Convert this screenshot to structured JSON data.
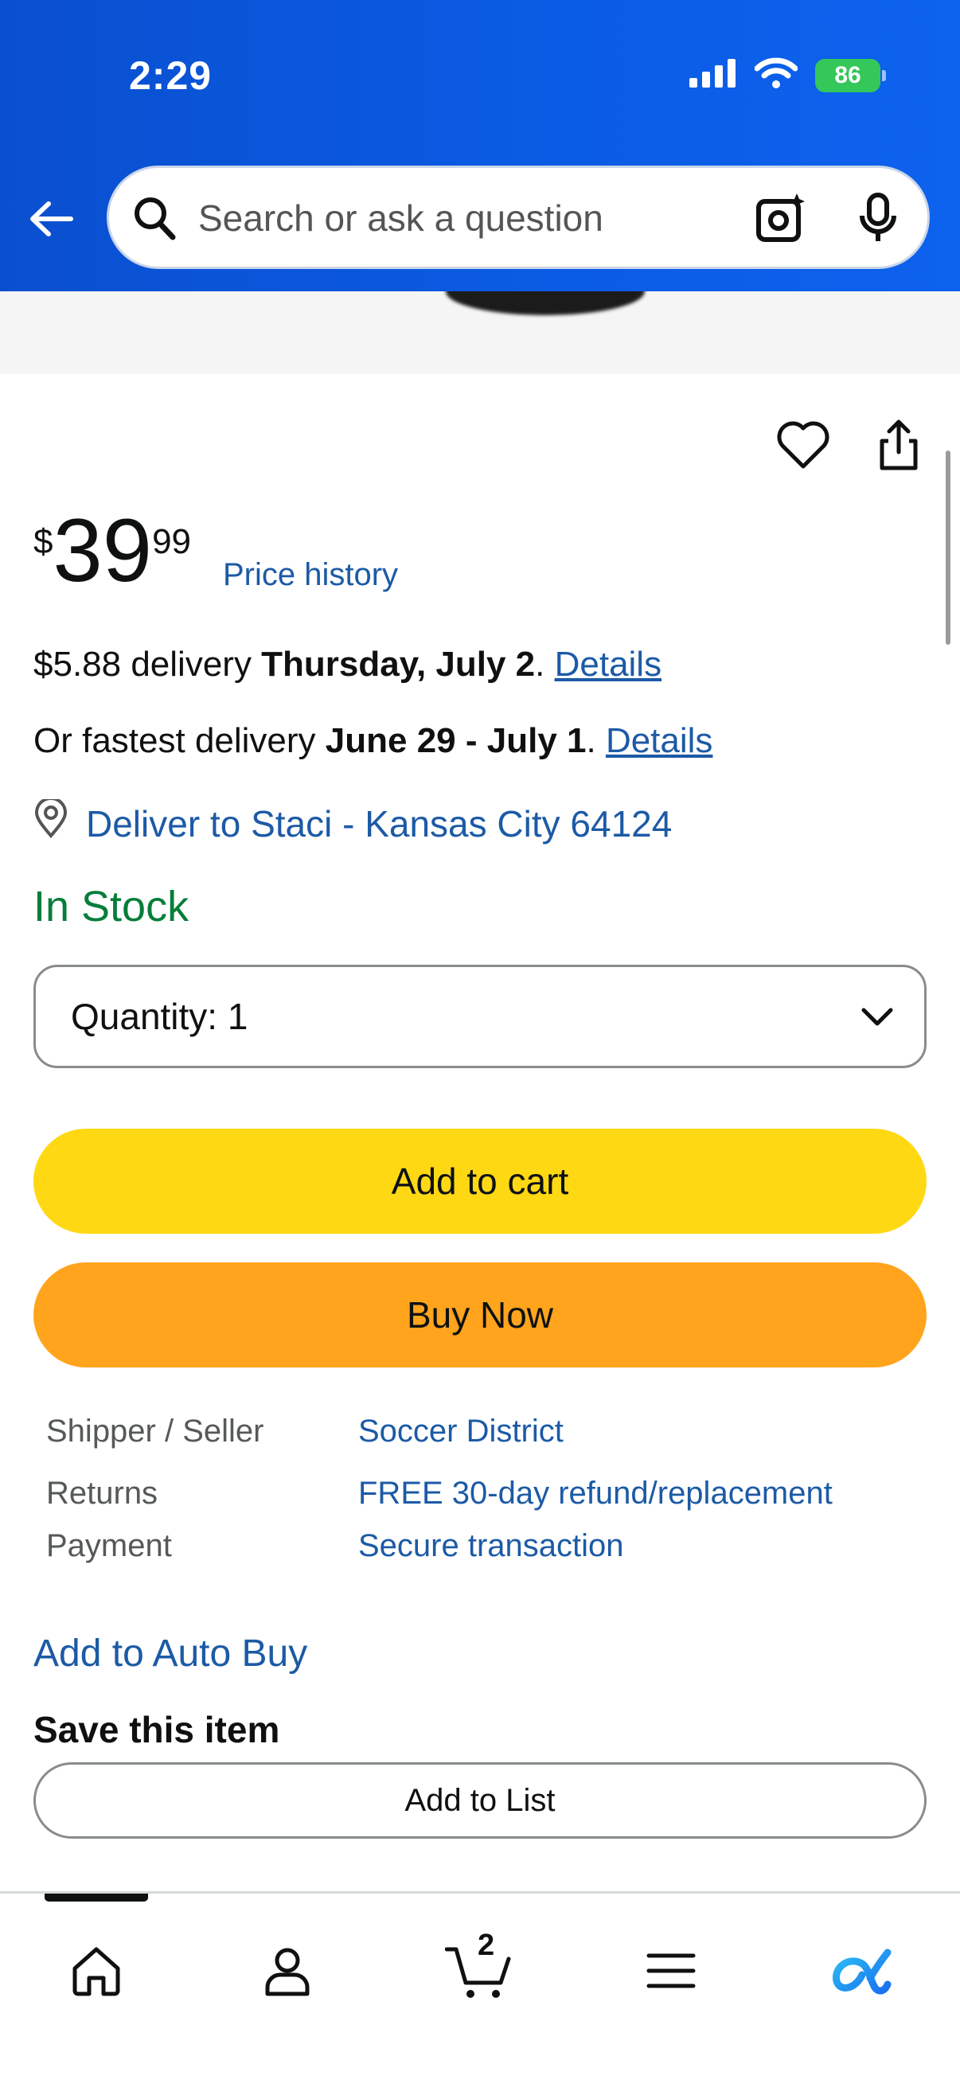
{
  "status_bar": {
    "time": "2:29",
    "battery": "86"
  },
  "search": {
    "placeholder": "Search or ask a question"
  },
  "product": {
    "price_symbol": "$",
    "price_whole": "39",
    "price_fraction": "99",
    "price_history_label": "Price history"
  },
  "delivery": {
    "line1_prefix": "$5.88 delivery ",
    "line1_date": "Thursday, July 2",
    "line1_period": ". ",
    "line1_link": "Details",
    "line2_prefix": "Or fastest delivery ",
    "line2_date": "June 29 - July 1",
    "line2_period": ". ",
    "line2_link": "Details",
    "deliver_to": "Deliver to Staci - Kansas City 64124"
  },
  "stock_status": "In Stock",
  "quantity": {
    "label": "Quantity:",
    "value": "1"
  },
  "buttons": {
    "add_to_cart": "Add to cart",
    "buy_now": "Buy Now",
    "add_to_list": "Add to List"
  },
  "info": [
    {
      "key": "Shipper / Seller",
      "value": "Soccer District"
    },
    {
      "key": "Returns",
      "value": "FREE 30-day refund/replacement"
    },
    {
      "key": "Payment",
      "value": "Secure transaction"
    }
  ],
  "auto_buy_label": "Add to Auto Buy",
  "save_title": "Save this item",
  "nav": {
    "cart_count": "2"
  },
  "colors": {
    "header": "#0b5be3",
    "add_to_cart": "#ffd814",
    "buy_now": "#ffa41c",
    "link": "#1c5aa6",
    "in_stock": "#067d39"
  }
}
